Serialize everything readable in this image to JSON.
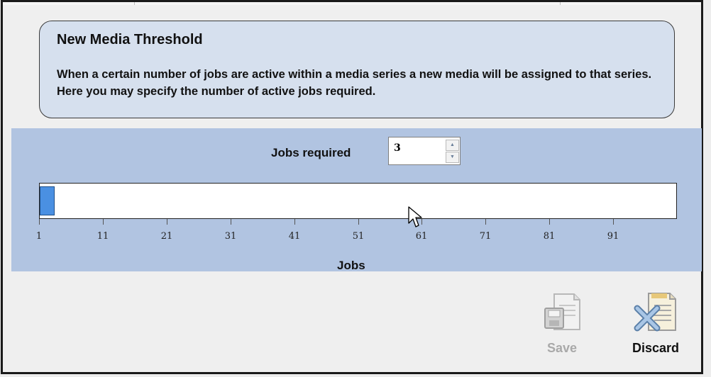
{
  "dialog": {
    "title": "New Media Threshold",
    "description": "When a certain number of jobs are active within a media series a new media will be assigned to that series. Here you may specify the number of active jobs required."
  },
  "jobs": {
    "label": "Jobs required",
    "value": "3",
    "slider_min": 1,
    "slider_max": 100,
    "slider_value": 3,
    "tick_labels": [
      "1",
      "11",
      "21",
      "31",
      "41",
      "51",
      "61",
      "71",
      "81",
      "91"
    ],
    "axis_title": "Jobs"
  },
  "actions": {
    "save_label": "Save",
    "discard_label": "Discard",
    "save_icon": "save-document-icon",
    "discard_icon": "discard-document-icon"
  },
  "colors": {
    "panel_bg": "#b1c4e1",
    "info_bg": "#d6e0ee",
    "slider_fill": "#4a90e2",
    "disabled_text": "#a9a9a9"
  }
}
